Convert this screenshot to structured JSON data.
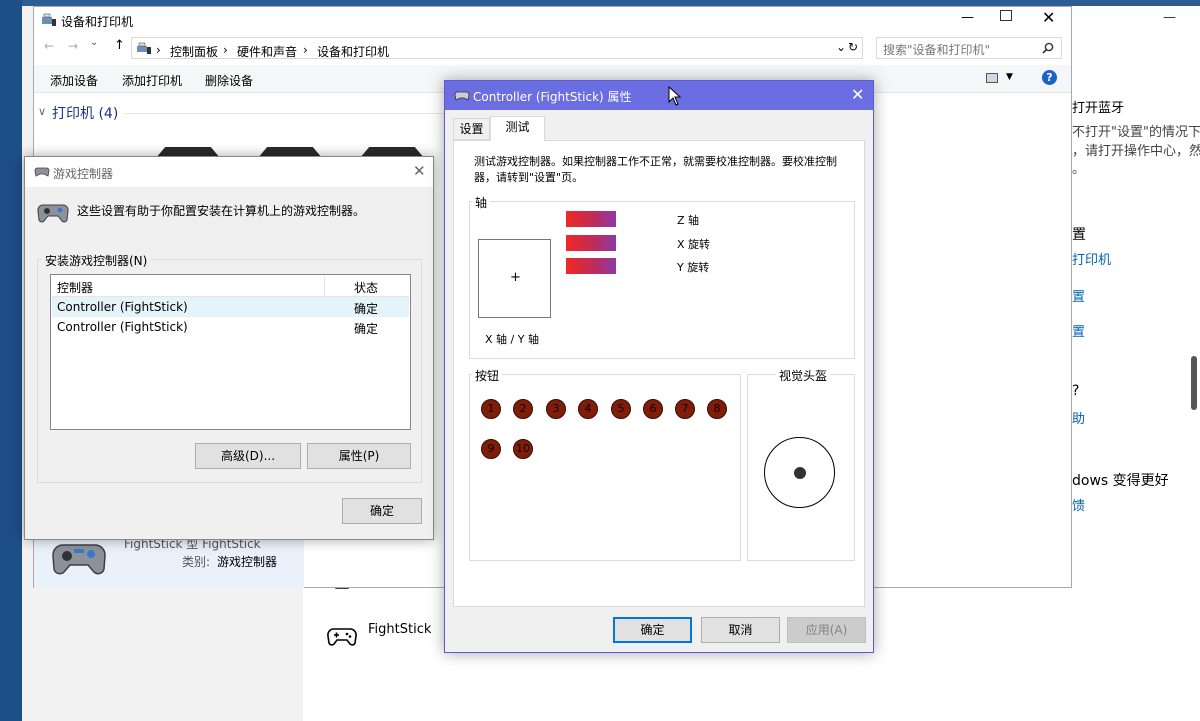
{
  "settings_bg": {
    "line_bluetooth": "打开蓝牙",
    "line_desc1": "不打开\"设置\"的情况下",
    "line_desc2": "，请打开操作中心，然",
    "line_dot": "。",
    "heading_related": "置",
    "link_printer": "打印机",
    "link_2": "置",
    "link_3": "置",
    "heading_question": "?",
    "link_help": "助",
    "heading_better": "dows 变得更好",
    "link_feedback": "馈",
    "device_label": "FightStick",
    "min_glyph": "—"
  },
  "explorer": {
    "title": "设备和打印机",
    "breadcrumb": [
      "控制面板",
      "硬件和声音",
      "设备和打印机"
    ],
    "search_placeholder": "搜索\"设备和打印机\"",
    "commands": [
      "添加设备",
      "添加打印机",
      "删除设备"
    ],
    "group_printers": "打印机 (4)",
    "detail_category_label": "类别:",
    "detail_category_value": "游戏控制器",
    "detail_partial": "FightStick 型    FightStick",
    "nav_back": "←",
    "nav_forward": "→",
    "nav_up": "↑",
    "help": "?"
  },
  "game_controllers": {
    "title": "游戏控制器",
    "description": "这些设置有助于你配置安装在计算机上的游戏控制器。",
    "installed_label": "安装游戏控制器(N)",
    "col_controller": "控制器",
    "col_status": "状态",
    "rows": [
      {
        "name": "Controller (FightStick)",
        "status": "确定"
      },
      {
        "name": "Controller (FightStick)",
        "status": "确定"
      }
    ],
    "btn_advanced": "高级(D)...",
    "btn_properties": "属性(P)",
    "btn_ok": "确定"
  },
  "properties": {
    "title": "Controller (FightStick) 属性",
    "tab_settings": "设置",
    "tab_test": "测试",
    "instructions": "测试游戏控制器。如果控制器工作不正常，就需要校准控制器。要校准控制器，请转到\"设置\"页。",
    "axes_label": "轴",
    "z_axis": "Z 轴",
    "x_rotation": "X 旋转",
    "y_rotation": "Y 旋转",
    "xy_axis": "X 轴 / Y 轴",
    "crosshair": "+",
    "buttons_label": "按钮",
    "button_numbers": [
      "1",
      "2",
      "3",
      "4",
      "5",
      "6",
      "7",
      "8",
      "9",
      "10"
    ],
    "pov_label": "视觉头盔",
    "btn_ok": "确定",
    "btn_cancel": "取消",
    "btn_apply": "应用(A)"
  }
}
